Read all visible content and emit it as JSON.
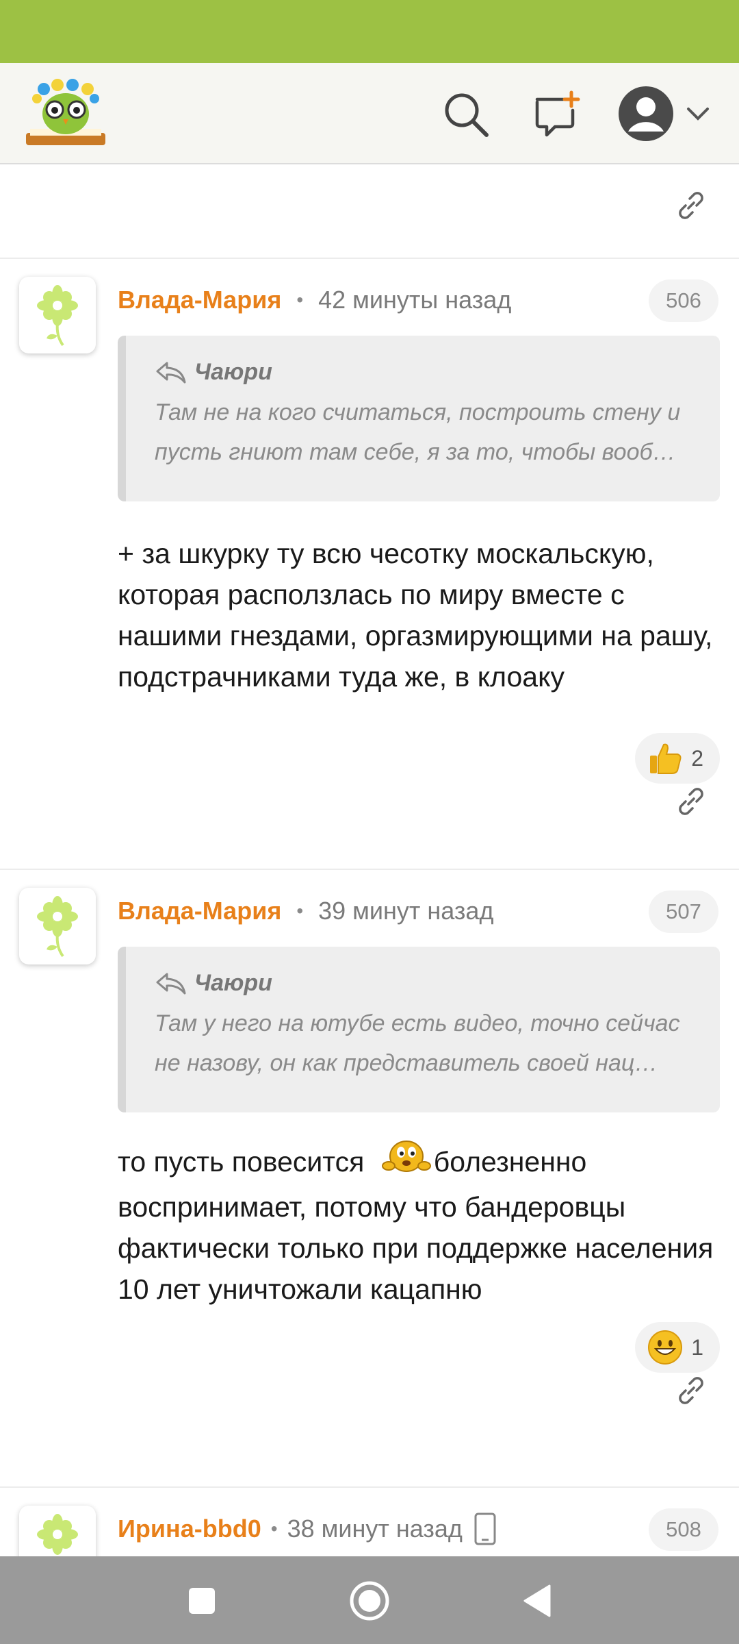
{
  "header": {
    "logo": "owl-with-book-logo",
    "icons": [
      "search-icon",
      "new-message-icon",
      "user-avatar-icon",
      "chevron-down-icon"
    ]
  },
  "comments": [
    {
      "author": "Влада-Мария",
      "time": "42 минуты назад",
      "number": "506",
      "quote_author": "Чаюри",
      "quote_text": "Там не на кого считаться, построить стену и пусть гниют там себе, я за то, чтобы вооб…",
      "text": "+ за шкурку ту всю чесотку москальскую, которая расползлась по миру вместе с нашими гнездами, оргазмирующими на рашу, подстрачниками туда же, в клоаку",
      "reaction_icon": "thumbs-up-icon",
      "reaction_count": "2"
    },
    {
      "author": "Влада-Мария",
      "time": "39 минут назад",
      "number": "507",
      "quote_author": "Чаюри",
      "quote_text": "Там у него на ютубе есть видео, точно сейчас не назову, он как представитель своей нац…",
      "text_before": "то пусть повесится",
      "inline_emoji": "yellow-smiley-emoji",
      "text_after": "болезненно воспринимает, потому что бандеровцы фактически только при поддержке населения 10 лет уничтожали кацапню",
      "reaction_icon": "smile-emoji-icon",
      "reaction_count": "1"
    },
    {
      "author": "Ирина-bbd0",
      "time": "38 минут назад",
      "number": "508",
      "device_icon": "mobile-phone-icon"
    }
  ],
  "colors": {
    "status_bar": "#9dc144",
    "author": "#e8801a",
    "nav_bar": "#9a9a9a"
  }
}
